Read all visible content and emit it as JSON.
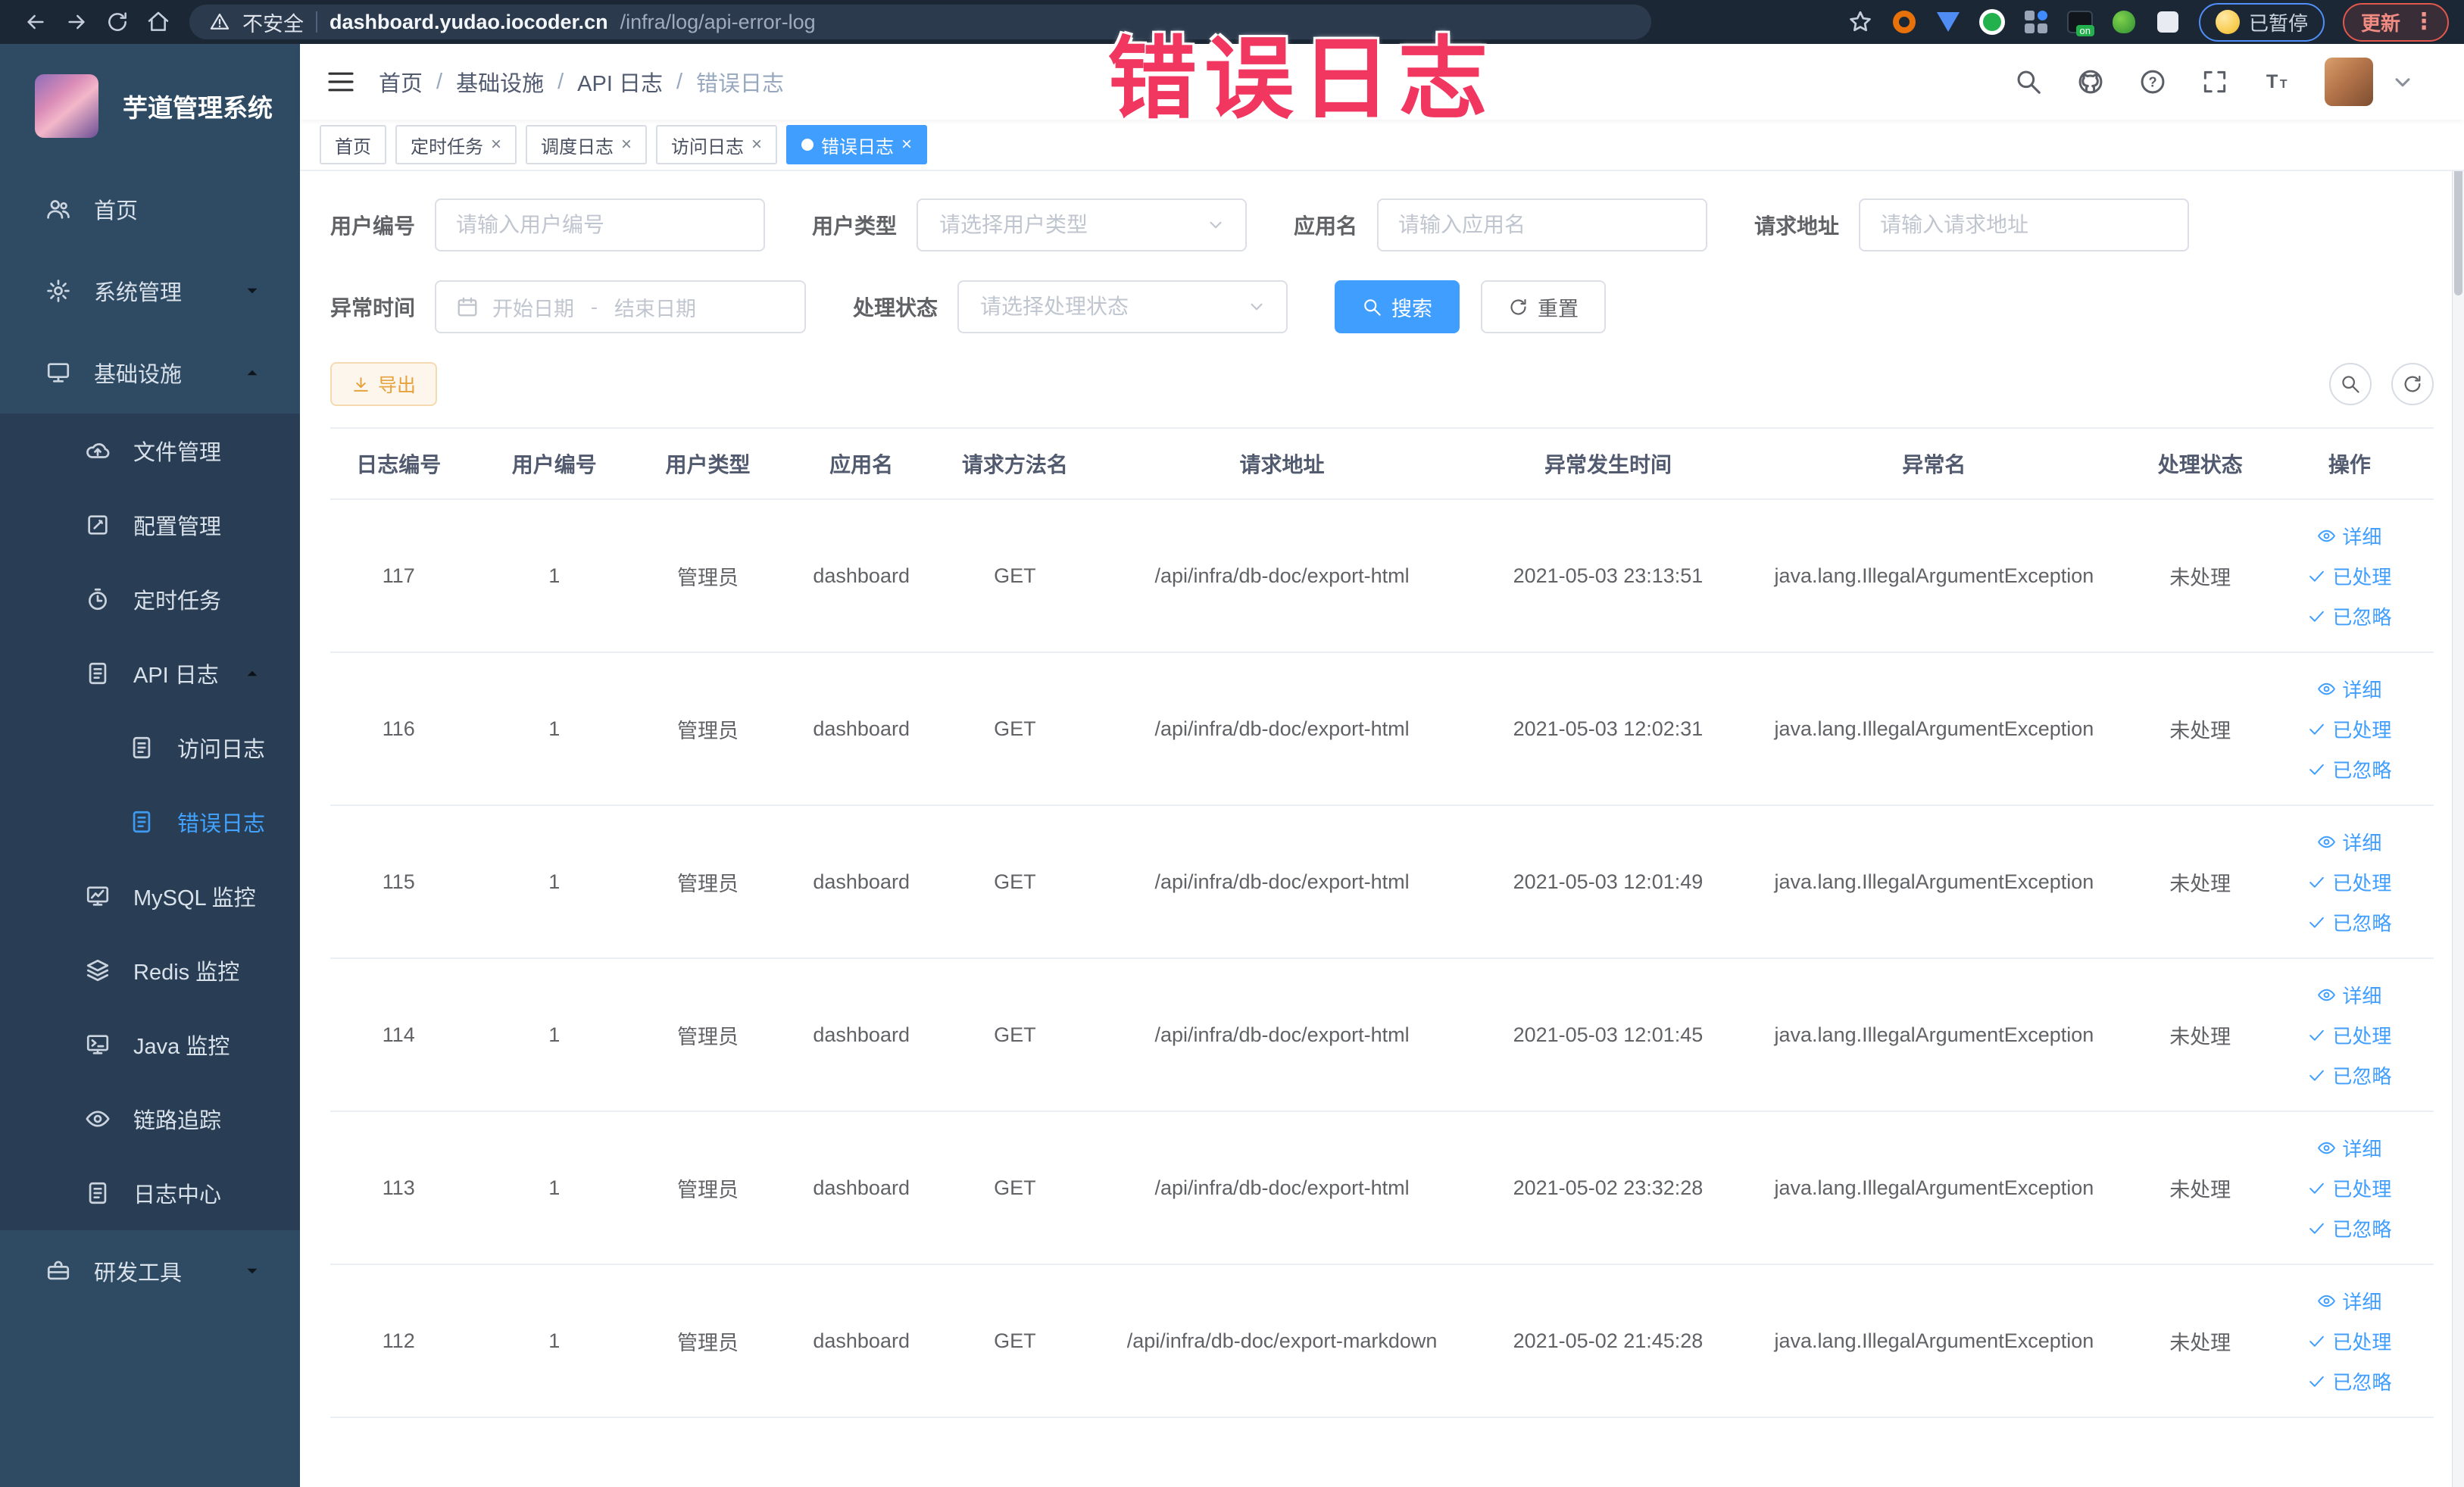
{
  "browser": {
    "security_label": "不安全",
    "url_domain": "dashboard.yudao.iocoder.cn",
    "url_path": "/infra/log/api-error-log",
    "paused_badge": "已暂停",
    "update_button": "更新"
  },
  "watermark": {
    "text": "错误日志"
  },
  "sidebar": {
    "title": "芋道管理系统",
    "items": [
      {
        "label": "首页"
      },
      {
        "label": "系统管理"
      },
      {
        "label": "基础设施"
      },
      {
        "label": "文件管理"
      },
      {
        "label": "配置管理"
      },
      {
        "label": "定时任务"
      },
      {
        "label": "API 日志"
      },
      {
        "label": "访问日志"
      },
      {
        "label": "错误日志"
      },
      {
        "label": "MySQL 监控"
      },
      {
        "label": "Redis 监控"
      },
      {
        "label": "Java 监控"
      },
      {
        "label": "链路追踪"
      },
      {
        "label": "日志中心"
      },
      {
        "label": "研发工具"
      }
    ]
  },
  "breadcrumb": {
    "separator": "/",
    "items": [
      "首页",
      "基础设施",
      "API 日志",
      "错误日志"
    ]
  },
  "tags": {
    "close_glyph": "×",
    "items": [
      {
        "label": "首页"
      },
      {
        "label": "定时任务"
      },
      {
        "label": "调度日志"
      },
      {
        "label": "访问日志"
      },
      {
        "label": "错误日志"
      }
    ]
  },
  "filters": {
    "user_id_label": "用户编号",
    "user_id_placeholder": "请输入用户编号",
    "user_type_label": "用户类型",
    "user_type_placeholder": "请选择用户类型",
    "app_name_label": "应用名",
    "app_name_placeholder": "请输入应用名",
    "request_url_label": "请求地址",
    "request_url_placeholder": "请输入请求地址",
    "exception_time_label": "异常时间",
    "date_start_placeholder": "开始日期",
    "date_separator": "-",
    "date_end_placeholder": "结束日期",
    "process_status_label": "处理状态",
    "process_status_placeholder": "请选择处理状态",
    "search_label": "搜索",
    "reset_label": "重置"
  },
  "toolbar": {
    "export_label": "导出"
  },
  "table": {
    "columns": [
      "日志编号",
      "用户编号",
      "用户类型",
      "应用名",
      "请求方法名",
      "请求地址",
      "异常发生时间",
      "异常名",
      "处理状态",
      "操作"
    ],
    "action_detail": "详细",
    "action_processed": "已处理",
    "action_ignored": "已忽略",
    "rows": [
      {
        "id": "117",
        "user_id": "1",
        "user_type": "管理员",
        "app": "dashboard",
        "method": "GET",
        "url": "/api/infra/db-doc/export-html",
        "time": "2021-05-03 23:13:51",
        "exception": "java.lang.IllegalArgumentException",
        "status": "未处理"
      },
      {
        "id": "116",
        "user_id": "1",
        "user_type": "管理员",
        "app": "dashboard",
        "method": "GET",
        "url": "/api/infra/db-doc/export-html",
        "time": "2021-05-03 12:02:31",
        "exception": "java.lang.IllegalArgumentException",
        "status": "未处理"
      },
      {
        "id": "115",
        "user_id": "1",
        "user_type": "管理员",
        "app": "dashboard",
        "method": "GET",
        "url": "/api/infra/db-doc/export-html",
        "time": "2021-05-03 12:01:49",
        "exception": "java.lang.IllegalArgumentException",
        "status": "未处理"
      },
      {
        "id": "114",
        "user_id": "1",
        "user_type": "管理员",
        "app": "dashboard",
        "method": "GET",
        "url": "/api/infra/db-doc/export-html",
        "time": "2021-05-03 12:01:45",
        "exception": "java.lang.IllegalArgumentException",
        "status": "未处理"
      },
      {
        "id": "113",
        "user_id": "1",
        "user_type": "管理员",
        "app": "dashboard",
        "method": "GET",
        "url": "/api/infra/db-doc/export-html",
        "time": "2021-05-02 23:32:28",
        "exception": "java.lang.IllegalArgumentException",
        "status": "未处理"
      },
      {
        "id": "112",
        "user_id": "1",
        "user_type": "管理员",
        "app": "dashboard",
        "method": "GET",
        "url": "/api/infra/db-doc/export-markdown",
        "time": "2021-05-02 21:45:28",
        "exception": "java.lang.IllegalArgumentException",
        "status": "未处理"
      }
    ]
  },
  "colors": {
    "primary": "#409EFF",
    "warning": "#E6A23C",
    "sidebar_bg": "#2F4A63",
    "sidebar_submenu_bg": "#293E54",
    "chrome_bg": "#1C2736",
    "watermark": "#F1375F"
  },
  "icons": [
    "back-icon",
    "forward-icon",
    "reload-icon",
    "home-icon",
    "warning-icon",
    "star-icon",
    "search-icon",
    "github-icon",
    "help-icon",
    "fullscreen-icon",
    "font-size-icon",
    "hamburger-icon",
    "calendar-icon",
    "refresh-icon",
    "download-icon",
    "eye-icon",
    "check-icon",
    "chevron-down-icon",
    "chevron-up-icon"
  ]
}
